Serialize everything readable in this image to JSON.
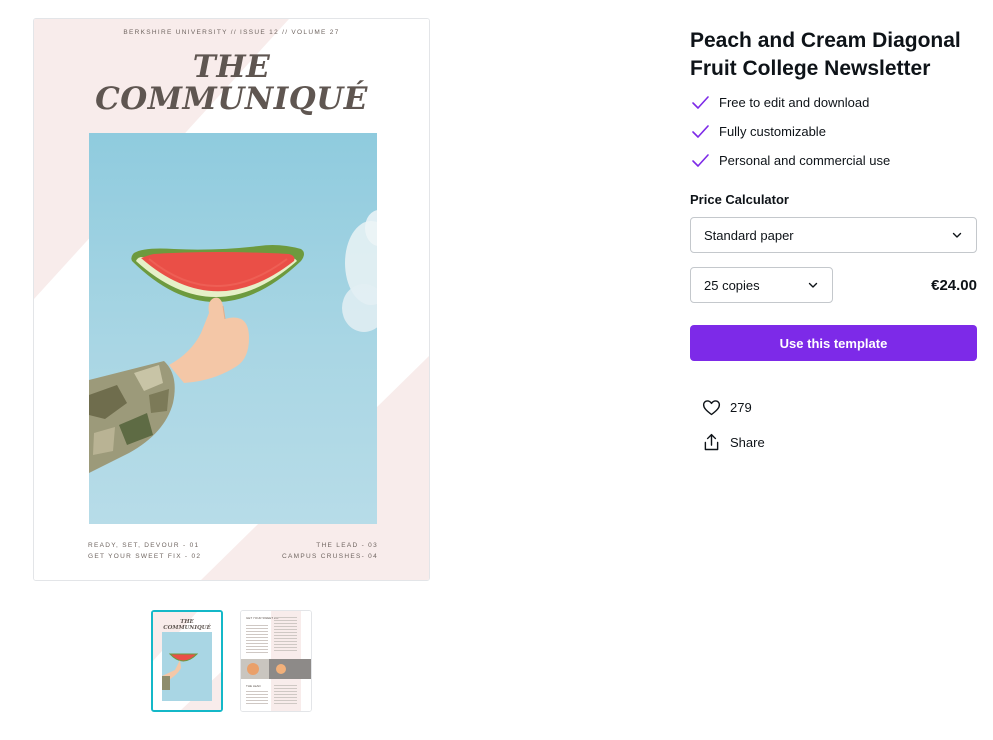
{
  "template": {
    "title": "Peach and Cream Diagonal Fruit College Newsletter"
  },
  "features": [
    {
      "label": "Free to edit and download",
      "icon": "check-icon"
    },
    {
      "label": "Fully customizable",
      "icon": "check-icon"
    },
    {
      "label": "Personal and commercial use",
      "icon": "check-icon"
    }
  ],
  "price_calculator": {
    "label": "Price Calculator",
    "paper": "Standard paper",
    "copies": "25 copies",
    "price": "€24.00"
  },
  "cta": {
    "label": "Use this template"
  },
  "actions": {
    "likes": "279",
    "share_label": "Share"
  },
  "preview": {
    "issue_line": "BERKSHIRE UNIVERSITY // ISSUE 12 // VOLUME 27",
    "masthead_line1": "THE",
    "masthead_line2": "COMMUNIQUÉ",
    "toc_left": [
      "READY, SET, DEVOUR - 01",
      "GET YOUR SWEET FIX - 02"
    ],
    "toc_right": [
      "THE LEAD - 03",
      "CAMPUS CRUSHES- 04"
    ]
  },
  "thumbnails": [
    {
      "page": 1,
      "masthead_line1": "THE",
      "masthead_line2": "COMMUNIQUÉ"
    },
    {
      "page": 2,
      "heading": "GET YOUR SWEET FIX",
      "subheading": "THE LEAD"
    }
  ],
  "colors": {
    "accent": "#7d2ae8",
    "active_thumb_border": "#14b8c8",
    "cover_pink": "#f8eceb",
    "sky": "#a9d6e4",
    "masthead": "#5f5651"
  }
}
